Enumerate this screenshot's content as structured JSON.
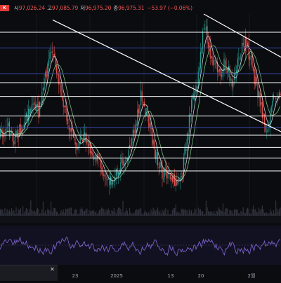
{
  "header": {
    "badge_label": "K",
    "open_label": "시",
    "open_value": "97,026.24",
    "high_label": "고",
    "high_value": "97,085.79",
    "low_label": "저",
    "low_value": "96,975.20",
    "close_label": "종",
    "close_value": "96,975.31",
    "change": "−53.97 (−0.06%)"
  },
  "colors": {
    "background": "#0b0c10",
    "up": "#26a69a",
    "down": "#ef5350",
    "ma_light": "#d9dce3",
    "ma_green": "#7fd08a",
    "rsi": "#7b61c9",
    "trendline": "#ffffff",
    "hline_blue": "#3a4cb0"
  },
  "chart_data": {
    "type": "line",
    "x_tick_labels": [
      "23",
      "2025",
      "13",
      "20",
      "2월"
    ],
    "price_series": {
      "description_points": [
        [
          0,
          0.62
        ],
        [
          10,
          0.58
        ],
        [
          20,
          0.64
        ],
        [
          35,
          0.55
        ],
        [
          45,
          0.45
        ],
        [
          55,
          0.5
        ],
        [
          65,
          0.3
        ],
        [
          72,
          0.18
        ],
        [
          80,
          0.28
        ],
        [
          90,
          0.45
        ],
        [
          100,
          0.6
        ],
        [
          110,
          0.68
        ],
        [
          120,
          0.62
        ],
        [
          130,
          0.7
        ],
        [
          140,
          0.75
        ],
        [
          150,
          0.82
        ],
        [
          160,
          0.86
        ],
        [
          170,
          0.78
        ],
        [
          180,
          0.72
        ],
        [
          190,
          0.6
        ],
        [
          200,
          0.42
        ],
        [
          210,
          0.55
        ],
        [
          220,
          0.7
        ],
        [
          230,
          0.82
        ],
        [
          240,
          0.8
        ],
        [
          250,
          0.86
        ],
        [
          260,
          0.78
        ],
        [
          270,
          0.5
        ],
        [
          280,
          0.35
        ],
        [
          290,
          0.05
        ],
        [
          300,
          0.22
        ],
        [
          310,
          0.3
        ],
        [
          320,
          0.25
        ],
        [
          330,
          0.35
        ],
        [
          340,
          0.2
        ],
        [
          350,
          0.15
        ],
        [
          360,
          0.3
        ],
        [
          370,
          0.45
        ],
        [
          380,
          0.62
        ],
        [
          390,
          0.4
        ],
        [
          400,
          0.42
        ]
      ]
    },
    "rsi_series": {
      "baseline": 0.5
    },
    "horizontal_levels": [
      {
        "level": 0.093,
        "color": "white"
      },
      {
        "level": 0.173,
        "color": "blue"
      },
      {
        "level": 0.305,
        "color": "blue"
      },
      {
        "level": 0.35,
        "color": "white"
      },
      {
        "level": 0.42,
        "color": "white"
      },
      {
        "level": 0.52,
        "color": "white"
      },
      {
        "level": 0.58,
        "color": "blue"
      },
      {
        "level": 0.618,
        "color": "white"
      },
      {
        "level": 0.68,
        "color": "white"
      },
      {
        "level": 0.735,
        "color": "white"
      },
      {
        "level": 0.8,
        "color": "white"
      }
    ],
    "trendlines": [
      {
        "from": [
          75,
          0.03
        ],
        "to": [
          400,
          0.6
        ]
      },
      {
        "from": [
          290,
          0.0
        ],
        "to": [
          400,
          0.22
        ]
      }
    ]
  }
}
